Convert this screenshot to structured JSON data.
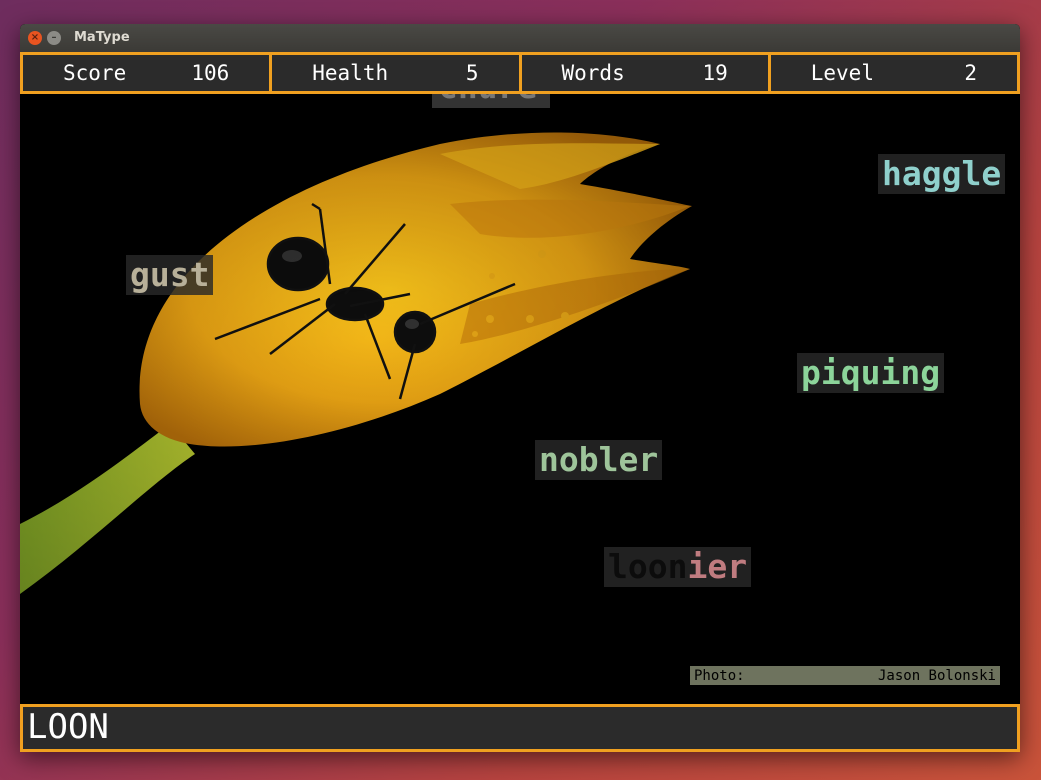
{
  "window": {
    "title": "MaType"
  },
  "hud": [
    {
      "label": "Score",
      "value": "106"
    },
    {
      "label": "Health",
      "value": "5"
    },
    {
      "label": "Words",
      "value": "19"
    },
    {
      "label": "Level",
      "value": "2"
    }
  ],
  "words": [
    {
      "text": "haggle",
      "typed": "",
      "rest": "haggle",
      "color": "#8fd0cc"
    },
    {
      "text": "gust",
      "typed": "",
      "rest": "gust",
      "color": "#b8b099"
    },
    {
      "text": "piquing",
      "typed": "",
      "rest": "piquing",
      "color": "#8cd49a"
    },
    {
      "text": "nobler",
      "typed": "",
      "rest": "nobler",
      "color": "#9ec49a"
    },
    {
      "text": "loonier",
      "typed": "loon",
      "rest": "ier",
      "color": "#c07c80"
    }
  ],
  "credit": {
    "label": "Photo:",
    "author": "Jason Bolonski"
  },
  "input": {
    "value": "LOON"
  },
  "colors": {
    "accent": "#f0a020",
    "panel": "#2b2b2b"
  }
}
